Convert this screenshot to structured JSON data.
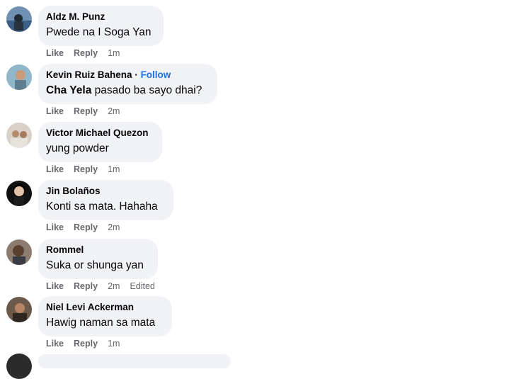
{
  "colors": {
    "bubble": "#f0f2f5",
    "action_gray": "#65676b",
    "follow_blue": "#216fdb",
    "text": "#050505"
  },
  "comments": [
    {
      "author": "Aldz M. Punz",
      "text": "Pwede na I Soga Yan",
      "like": "Like",
      "reply": "Reply",
      "time": "1m"
    },
    {
      "author": "Kevin Ruiz Bahena",
      "dot": "·",
      "follow": "Follow",
      "mention": "Cha Yela",
      "text": " pasado ba sayo dhai?",
      "like": "Like",
      "reply": "Reply",
      "time": "2m"
    },
    {
      "author": "Victor Michael Quezon",
      "text": "yung powder",
      "like": "Like",
      "reply": "Reply",
      "time": "1m"
    },
    {
      "author": "Jin Bolaños",
      "text": "Konti sa mata. Hahaha",
      "like": "Like",
      "reply": "Reply",
      "time": "2m"
    },
    {
      "author": "Rommel",
      "text": "Suka or shunga yan",
      "like": "Like",
      "reply": "Reply",
      "time": "2m",
      "edited": "Edited"
    },
    {
      "author": "Niel Levi Ackerman",
      "text": "Hawig naman sa mata",
      "like": "Like",
      "reply": "Reply",
      "time": "1m"
    }
  ]
}
